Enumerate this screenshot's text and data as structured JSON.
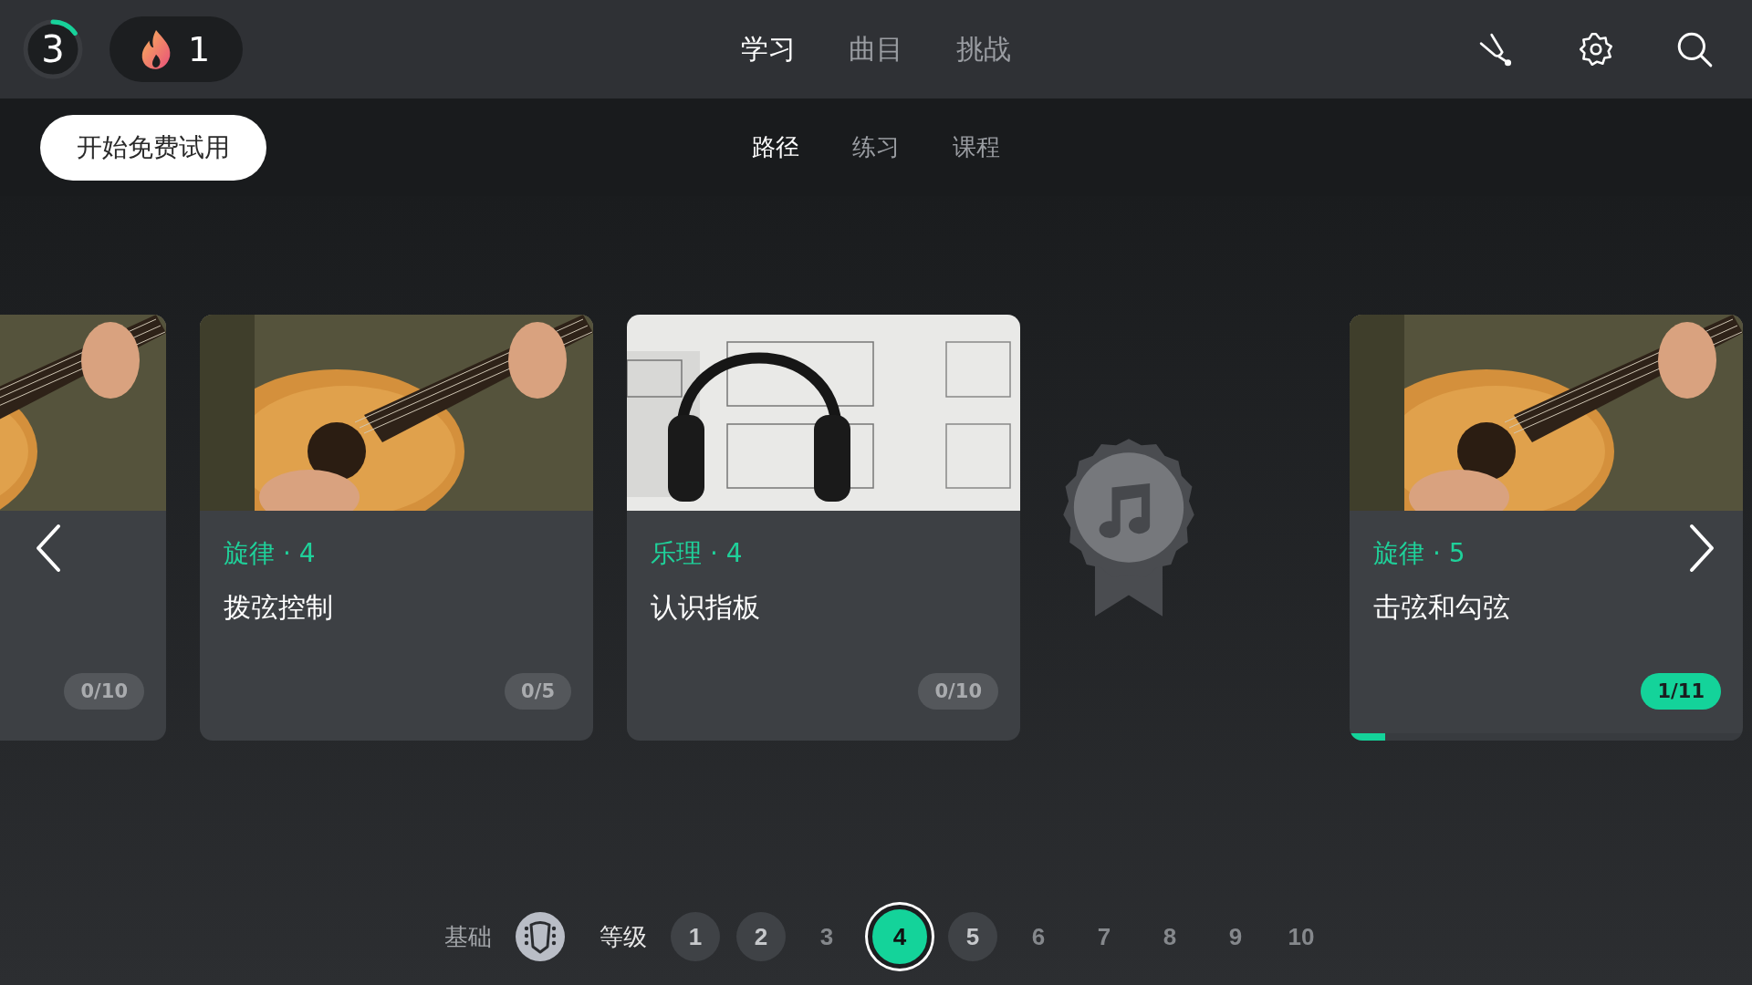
{
  "top_bar": {
    "level_ring": {
      "label": "3",
      "level": 0.15
    },
    "streak": {
      "count": "1"
    },
    "tabs": [
      {
        "label": "学习",
        "selected": true
      },
      {
        "label": "曲目",
        "selected": false
      },
      {
        "label": "挑战",
        "selected": false
      }
    ]
  },
  "sub_bar": {
    "trial_button": "开始免费试用",
    "tabs": [
      {
        "label": "路径",
        "selected": true
      },
      {
        "label": "练习",
        "selected": false
      },
      {
        "label": "课程",
        "selected": false
      }
    ]
  },
  "cards": [
    {
      "kind": "lesson",
      "progress": "0/10",
      "started": false
    },
    {
      "kind": "lesson",
      "category": "旋律 · 4",
      "title": "拨弦控制",
      "progress": "0/5",
      "started": false
    },
    {
      "kind": "lesson",
      "category": "乐理 · 4",
      "title": "认识指板",
      "progress": "0/10",
      "started": false
    },
    {
      "kind": "reward"
    },
    {
      "kind": "lesson",
      "category": "旋律 · 5",
      "title": "击弦和勾弦",
      "progress": "1/11",
      "started": true,
      "level": 0.09
    }
  ],
  "level_bar": {
    "basics_label": "基础",
    "levels_label": "等级",
    "levels": [
      {
        "label": "1",
        "highlighted": true,
        "selected": false
      },
      {
        "label": "2",
        "highlighted": true,
        "selected": false
      },
      {
        "label": "3",
        "highlighted": false,
        "selected": false
      },
      {
        "label": "4",
        "highlighted": false,
        "selected": true
      },
      {
        "label": "5",
        "highlighted": true,
        "selected": false
      },
      {
        "label": "6",
        "highlighted": false,
        "selected": false
      },
      {
        "label": "7",
        "highlighted": false,
        "selected": false
      },
      {
        "label": "8",
        "highlighted": false,
        "selected": false
      },
      {
        "label": "9",
        "highlighted": false,
        "selected": false
      },
      {
        "label": "10",
        "highlighted": false,
        "selected": false
      }
    ]
  }
}
